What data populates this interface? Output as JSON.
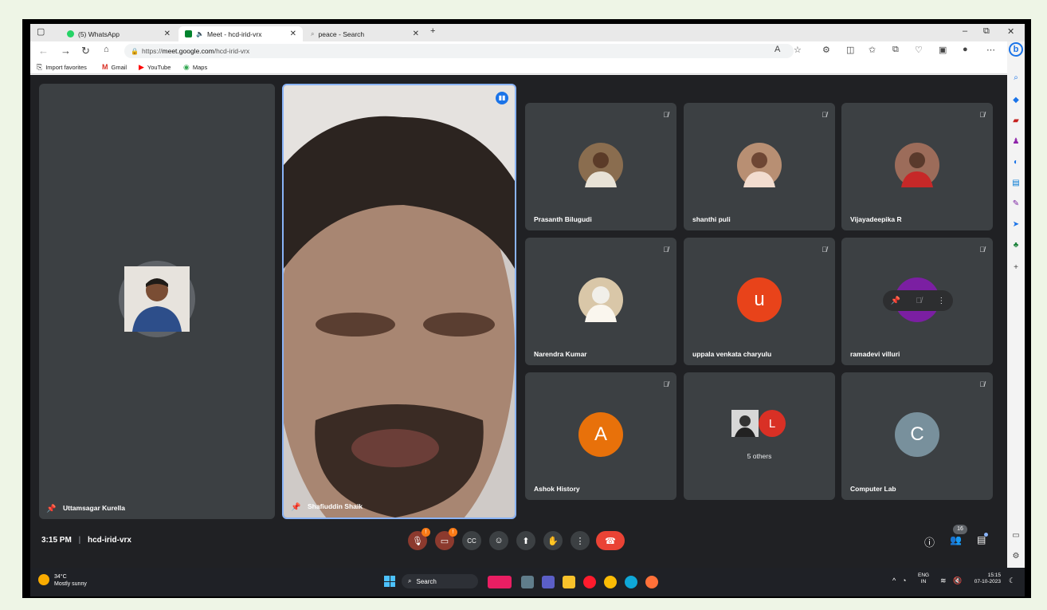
{
  "browser": {
    "tabs": [
      {
        "label": "(5) WhatsApp",
        "color": "#25d366"
      },
      {
        "label": "Meet - hcd-irid-vrx",
        "color": "#00832d"
      },
      {
        "label": "peace - Search",
        "color": "#9aa0a6"
      }
    ],
    "url_prefix": "https://",
    "url_host": "meet.google.com",
    "url_path": "/hcd-irid-vrx",
    "bookmarks": [
      "Import favorites",
      "Gmail",
      "YouTube",
      "Maps"
    ]
  },
  "meet": {
    "pinned_left": {
      "name": "Uttamsagar Kurella"
    },
    "spotlight": {
      "name": "Shafiuddin Shaik"
    },
    "grid": [
      {
        "name": "Prasanth Bilugudi",
        "initial": "",
        "color": "#8a6d4f"
      },
      {
        "name": "shanthi puli",
        "initial": "",
        "color": "#b88f73"
      },
      {
        "name": "Vijayadeepika R",
        "initial": "",
        "color": "#9c6c5a"
      },
      {
        "name": "Narendra Kumar",
        "initial": "",
        "color": "#d9c7a8"
      },
      {
        "name": "uppala venkata charyulu",
        "initial": "u",
        "color": "#e8431a"
      },
      {
        "name": "ramadevi villuri",
        "initial": "",
        "color": "#7b1fa2"
      },
      {
        "name": "Ashok History",
        "initial": "A",
        "color": "#e8710a"
      },
      {
        "name": "5 others",
        "initial": "L",
        "color": "#d93025"
      },
      {
        "name": "Computer Lab",
        "initial": "C",
        "color": "#78909c"
      }
    ],
    "time": "3:15 PM",
    "meeting_code": "hcd-irid-vrx",
    "people_count": "16",
    "badges": {
      "mic": "!",
      "cam": "!"
    }
  },
  "taskbar": {
    "weather_temp": "34°C",
    "weather_desc": "Mostly sunny",
    "search_label": "Search",
    "lang": "ENG",
    "region": "IN",
    "clock_time": "15:15",
    "clock_date": "07-10-2023"
  }
}
